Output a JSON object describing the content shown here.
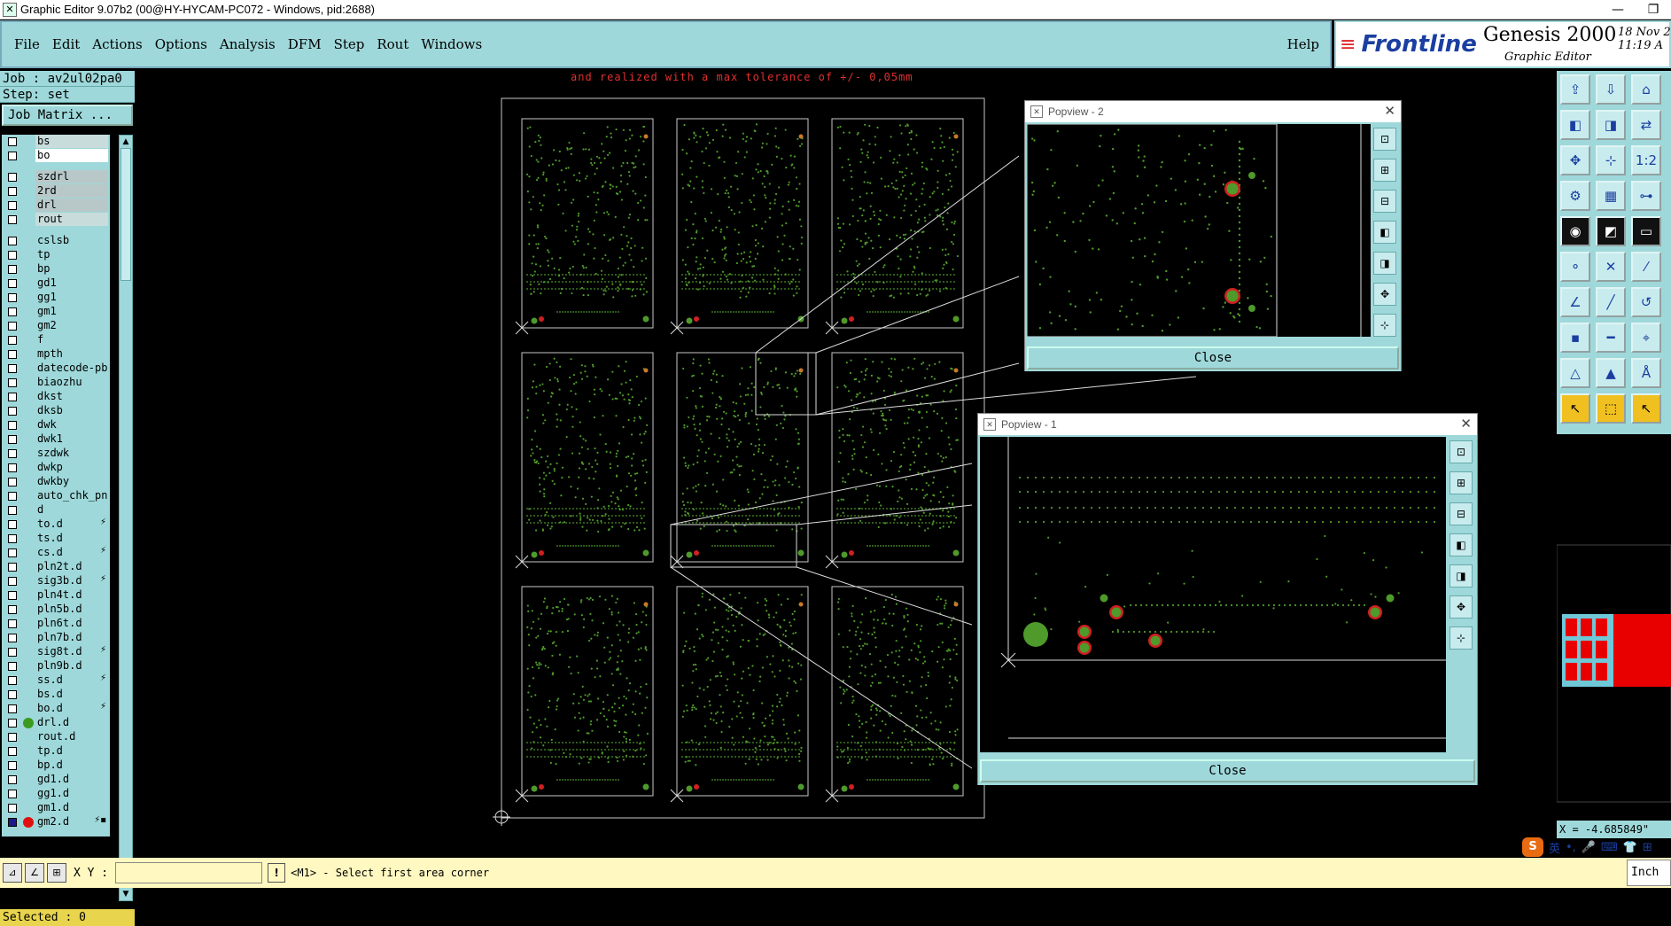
{
  "window": {
    "title": "Graphic Editor 9.07b2 (00@HY-HYCAM-PC072 - Windows, pid:2688)",
    "controls": [
      "—",
      "❐"
    ]
  },
  "menu": {
    "items": [
      "File",
      "Edit",
      "Actions",
      "Options",
      "Analysis",
      "DFM",
      "Step",
      "Rout",
      "Windows"
    ],
    "help": "Help"
  },
  "logo": {
    "brand": "Frontline",
    "product": "Genesis 2000",
    "subtitle": "Graphic Editor",
    "date_line1": "18 Nov 2",
    "date_line2": "11:19 A"
  },
  "left_panel": {
    "job": "Job : av2ul02pa0",
    "step": "Step: set",
    "job_matrix_button": "Job Matrix ...",
    "layers": [
      {
        "name": "bs",
        "style": "lt",
        "chk": false
      },
      {
        "name": "bo",
        "style": "white",
        "chk": false
      },
      {
        "gap": true
      },
      {
        "name": "szdrl",
        "style": "grey",
        "chk": false
      },
      {
        "name": "2rd",
        "style": "grey",
        "chk": false
      },
      {
        "name": "drl",
        "style": "grey",
        "chk": false
      },
      {
        "name": "rout",
        "style": "lt",
        "chk": false
      },
      {
        "gap": true
      },
      {
        "name": "cslsb",
        "chk": false
      },
      {
        "name": "tp",
        "chk": false
      },
      {
        "name": "bp",
        "chk": false
      },
      {
        "name": "gd1",
        "chk": false
      },
      {
        "name": "gg1",
        "chk": false
      },
      {
        "name": "gm1",
        "chk": false
      },
      {
        "name": "gm2",
        "chk": false
      },
      {
        "name": "f",
        "chk": false
      },
      {
        "name": "mpth",
        "chk": false
      },
      {
        "name": "datecode-pbo",
        "chk": false
      },
      {
        "name": "biaozhu",
        "chk": false
      },
      {
        "name": "dkst",
        "chk": false
      },
      {
        "name": "dksb",
        "chk": false
      },
      {
        "name": "dwk",
        "chk": false
      },
      {
        "name": "dwk1",
        "chk": false
      },
      {
        "name": "szdwk",
        "chk": false
      },
      {
        "name": "dwkp",
        "chk": false
      },
      {
        "name": "dwkby",
        "chk": false
      },
      {
        "name": "auto_chk_pnl",
        "chk": false
      },
      {
        "name": "d",
        "chk": false
      },
      {
        "name": "to.d",
        "chk": false,
        "mark": "⚡"
      },
      {
        "name": "ts.d",
        "chk": false
      },
      {
        "name": "cs.d",
        "chk": false,
        "mark": "⚡"
      },
      {
        "name": "pln2t.d",
        "chk": false
      },
      {
        "name": "sig3b.d",
        "chk": false,
        "mark": "⚡"
      },
      {
        "name": "pln4t.d",
        "chk": false
      },
      {
        "name": "pln5b.d",
        "chk": false
      },
      {
        "name": "pln6t.d",
        "chk": false
      },
      {
        "name": "pln7b.d",
        "chk": false
      },
      {
        "name": "sig8t.d",
        "chk": false,
        "mark": "⚡"
      },
      {
        "name": "pln9b.d",
        "chk": false
      },
      {
        "name": "ss.d",
        "chk": false,
        "mark": "⚡"
      },
      {
        "name": "bs.d",
        "chk": false
      },
      {
        "name": "bo.d",
        "chk": false,
        "mark": "⚡"
      },
      {
        "name": "drl.d",
        "chk": false,
        "dot": "#3c9a1e"
      },
      {
        "name": "rout.d",
        "chk": false
      },
      {
        "name": "tp.d",
        "chk": false
      },
      {
        "name": "bp.d",
        "chk": false
      },
      {
        "name": "gd1.d",
        "chk": false
      },
      {
        "name": "gg1.d",
        "chk": false
      },
      {
        "name": "gm1.d",
        "chk": false
      },
      {
        "name": "gm2.d",
        "chk": true,
        "dot": "#e01010",
        "mark": "⚡▪"
      }
    ],
    "selected": "Selected : 0"
  },
  "canvas": {
    "note": "and realized with a max tolerance of +/- 0,05mm"
  },
  "popview2": {
    "title": "Popview - 2",
    "close": "Close"
  },
  "popview1": {
    "title": "Popview - 1",
    "close": "Close"
  },
  "bottom": {
    "xy_label": "X Y :",
    "xy_value": "",
    "excl": "!",
    "status": "<M1> - Select first area corner",
    "units": "Inch"
  },
  "right": {
    "coord": "X = -4.685849\""
  },
  "ime": {
    "s": "S",
    "items": [
      "英",
      "•,",
      "🎤",
      "⌨",
      "👕",
      "⊞"
    ]
  },
  "colors": {
    "panel": "#9ed8da",
    "pcb_green": "#4e9a2a",
    "pad_red": "#d02020",
    "note_red": "#e03030"
  }
}
